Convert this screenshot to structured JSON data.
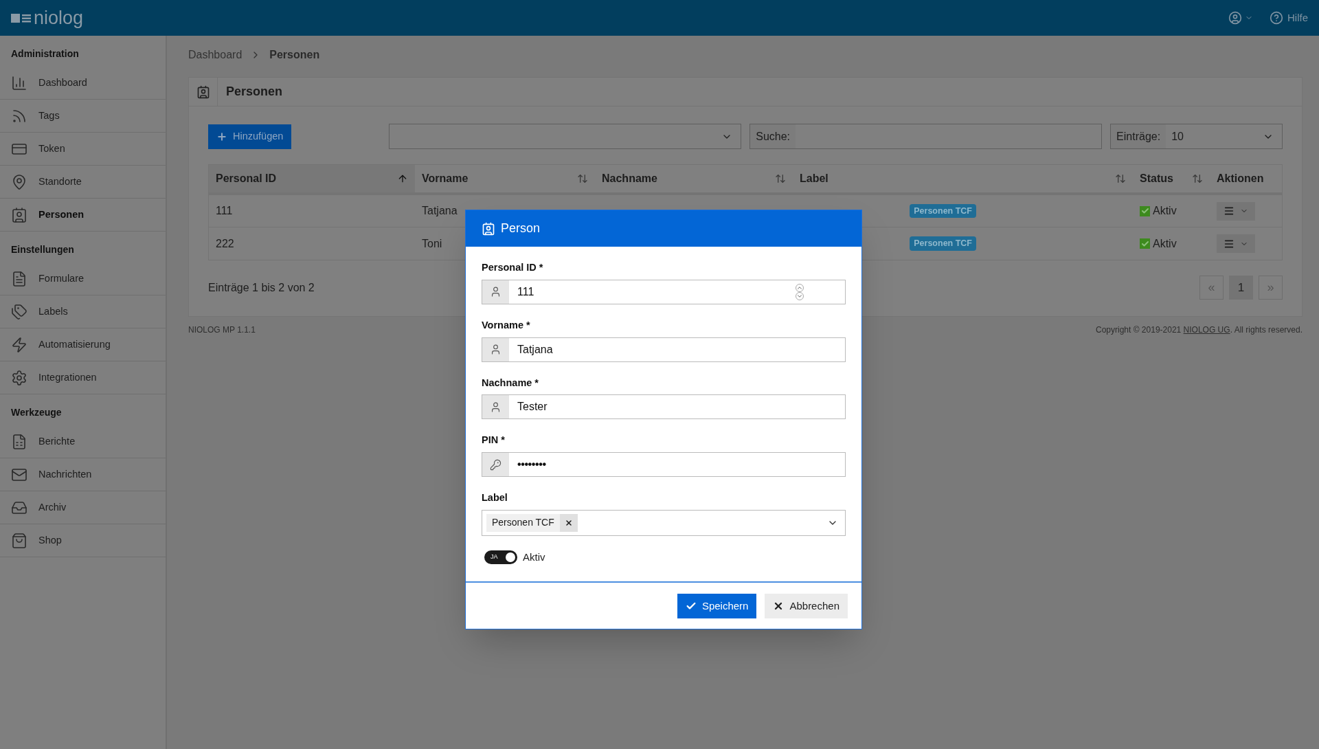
{
  "header": {
    "logo": "niolog",
    "help": "Hilfe"
  },
  "sidebar": {
    "sections": [
      {
        "title": "Administration",
        "items": [
          {
            "label": "Dashboard",
            "selected": false
          },
          {
            "label": "Tags",
            "selected": false
          },
          {
            "label": "Token",
            "selected": false
          },
          {
            "label": "Standorte",
            "selected": false
          },
          {
            "label": "Personen",
            "selected": true
          }
        ]
      },
      {
        "title": "Einstellungen",
        "items": [
          {
            "label": "Formulare",
            "selected": false
          },
          {
            "label": "Labels",
            "selected": false
          },
          {
            "label": "Automatisierung",
            "selected": false
          },
          {
            "label": "Integrationen",
            "selected": false
          }
        ]
      },
      {
        "title": "Werkzeuge",
        "items": [
          {
            "label": "Berichte",
            "selected": false
          },
          {
            "label": "Nachrichten",
            "selected": false
          },
          {
            "label": "Archiv",
            "selected": false
          },
          {
            "label": "Shop",
            "selected": false
          }
        ]
      }
    ]
  },
  "breadcrumb": [
    "Dashboard",
    "Personen"
  ],
  "card": {
    "title": "Personen",
    "add_button": "Hinzufügen",
    "search_label": "Suche:",
    "entries_label": "Einträge:",
    "entries_value": "10",
    "columns": [
      {
        "label": "Personal ID",
        "sortable": true,
        "sorted": true
      },
      {
        "label": "Vorname",
        "sortable": true,
        "sorted": false
      },
      {
        "label": "Nachname",
        "sortable": true,
        "sorted": false
      },
      {
        "label": "Label",
        "sortable": true,
        "sorted": false
      },
      {
        "label": "Status",
        "sortable": true,
        "sorted": false
      },
      {
        "label": "Aktionen",
        "sortable": false
      }
    ],
    "rows": [
      {
        "id": "111",
        "first": "Tatjana",
        "labels": [
          "Personen TCF"
        ],
        "status": "Aktiv",
        "active": true
      },
      {
        "id": "222",
        "first": "Toni",
        "labels": [
          "Personen TCF"
        ],
        "status": "Aktiv",
        "active": true
      }
    ],
    "info": "Einträge 1 bis 2 von 2",
    "pagination": {
      "prev": "«",
      "pages": [
        {
          "label": "1",
          "selected": true
        }
      ],
      "next": "»"
    }
  },
  "footer": {
    "version": "NIOLOG MP 1.1.1",
    "copyright_prefix": "Copyright © 2019-2021",
    "company_link": "NIOLOG UG",
    "copyright_suffix": ". All rights reserved."
  },
  "modal": {
    "title": "Person",
    "fields": [
      {
        "label": "Personal ID *",
        "value": "111",
        "kind": "number"
      },
      {
        "label": "Vorname *",
        "value": "Tatjana",
        "kind": "text"
      },
      {
        "label": "Nachname *",
        "value": "Tester",
        "kind": "text"
      },
      {
        "label": "PIN *",
        "value": "••••••••",
        "kind": "password"
      }
    ],
    "label_field": {
      "label": "Label",
      "tags": [
        "Personen TCF"
      ]
    },
    "toggle": {
      "text": "JA",
      "label": "Aktiv",
      "on": true
    },
    "save_button": "Speichern",
    "cancel_button": "Abbrechen"
  }
}
